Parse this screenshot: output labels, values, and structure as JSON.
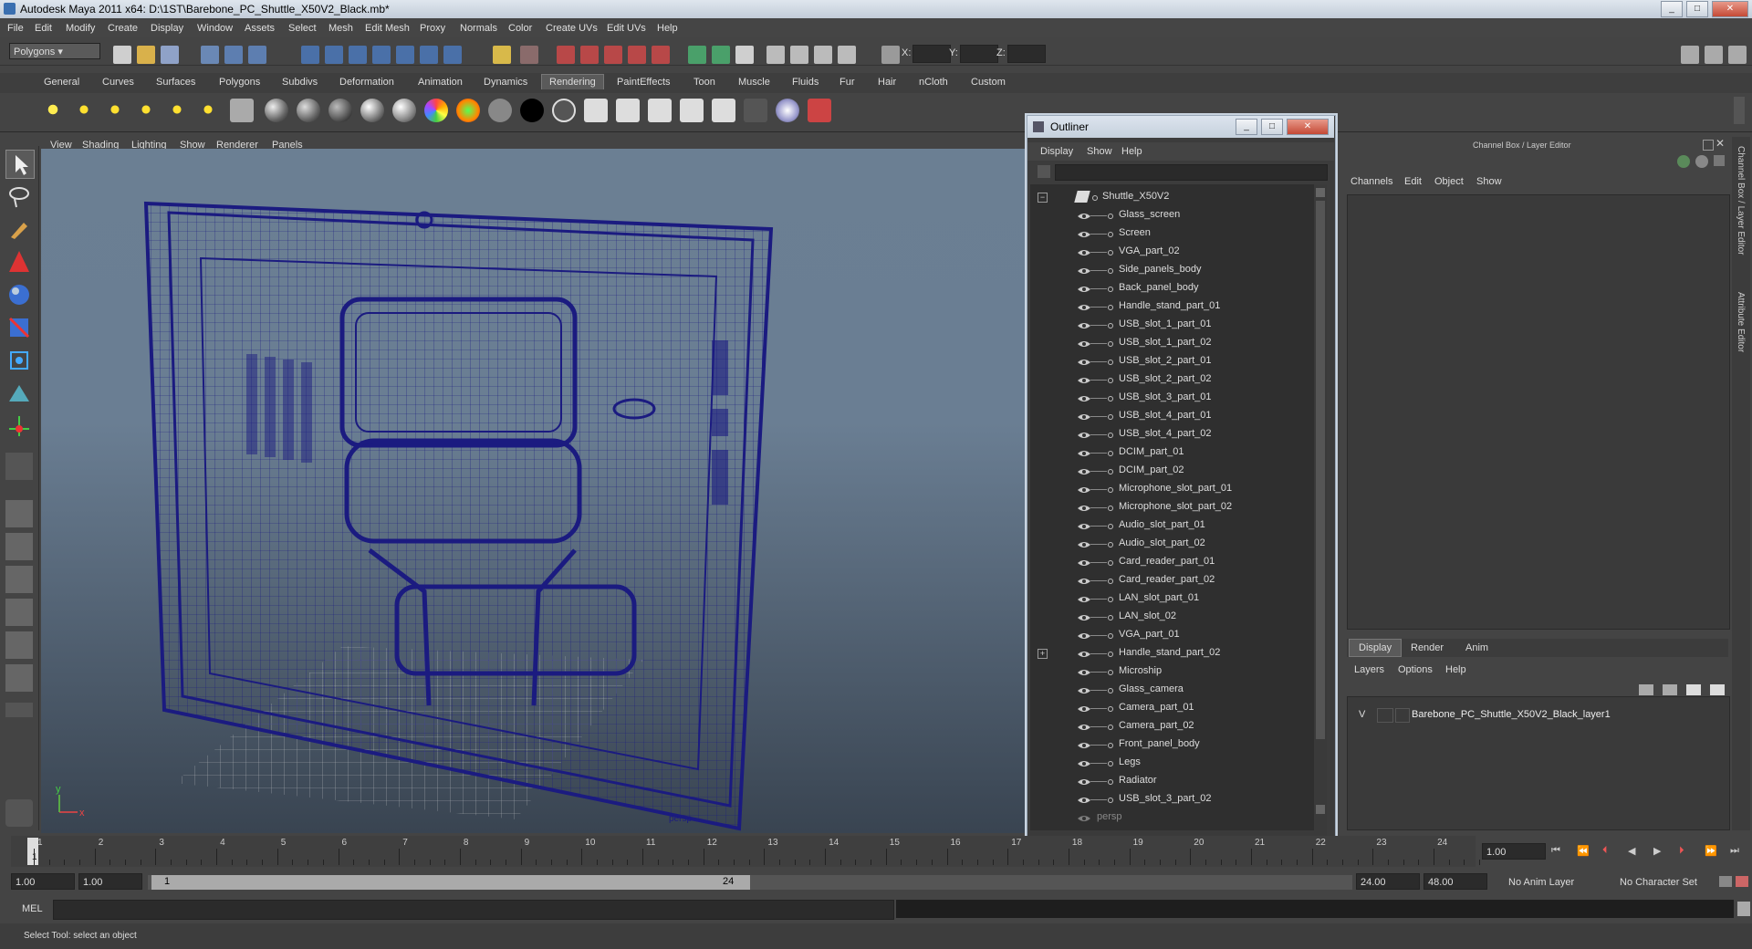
{
  "window": {
    "title": "Autodesk Maya 2011 x64: D:\\1ST\\Barebone_PC_Shuttle_X50V2_Black.mb*"
  },
  "menubar": [
    "File",
    "Edit",
    "Modify",
    "Create",
    "Display",
    "Window",
    "Assets",
    "Select",
    "Mesh",
    "Edit Mesh",
    "Proxy",
    "Normals",
    "Color",
    "Create UVs",
    "Edit UVs",
    "Help"
  ],
  "statusline": {
    "mode": "Polygons",
    "x_label": "X:",
    "y_label": "Y:",
    "z_label": "Z:"
  },
  "shelf": {
    "tabs": [
      "General",
      "Curves",
      "Surfaces",
      "Polygons",
      "Subdivs",
      "Deformation",
      "Animation",
      "Dynamics",
      "Rendering",
      "PaintEffects",
      "Toon",
      "Muscle",
      "Fluids",
      "Fur",
      "Hair",
      "nCloth",
      "Custom"
    ],
    "active": "Rendering"
  },
  "viewport": {
    "menu": [
      "View",
      "Shading",
      "Lighting",
      "Show",
      "Renderer",
      "Panels"
    ],
    "camera_label": "persp",
    "axis_x": "x",
    "axis_y": "y"
  },
  "outliner": {
    "title": "Outliner",
    "menu": [
      "Display",
      "Show",
      "Help"
    ],
    "root": "Shuttle_X50V2",
    "items": [
      "Glass_screen",
      "Screen",
      "VGA_part_02",
      "Side_panels_body",
      "Back_panel_body",
      "Handle_stand_part_01",
      "USB_slot_1_part_01",
      "USB_slot_1_part_02",
      "USB_slot_2_part_01",
      "USB_slot_2_part_02",
      "USB_slot_3_part_01",
      "USB_slot_4_part_01",
      "USB_slot_4_part_02",
      "DCIM_part_01",
      "DCIM_part_02",
      "Microphone_slot_part_01",
      "Microphone_slot_part_02",
      "Audio_slot_part_01",
      "Audio_slot_part_02",
      "Card_reader_part_01",
      "Card_reader_part_02",
      "LAN_slot_part_01",
      "LAN_slot_02",
      "VGA_part_01",
      "Handle_stand_part_02",
      "Microship",
      "Glass_camera",
      "Camera_part_01",
      "Camera_part_02",
      "Front_panel_body",
      "Legs",
      "Radiator",
      "USB_slot_3_part_02"
    ],
    "expandable_item": "Handle_stand_part_02",
    "camera": "persp"
  },
  "channelbox": {
    "title": "Channel Box / Layer Editor",
    "menu": [
      "Channels",
      "Edit",
      "Object",
      "Show"
    ],
    "side_tabs": [
      "Channel Box / Layer Editor",
      "Attribute Editor"
    ],
    "layer_tabs": [
      "Display",
      "Render",
      "Anim"
    ],
    "active_layer_tab": "Display",
    "layer_menu": [
      "Layers",
      "Options",
      "Help"
    ],
    "layer": {
      "visible": "V",
      "name": "Barebone_PC_Shuttle_X50V2_Black_layer1"
    }
  },
  "timeline": {
    "ticks": [
      "1",
      "2",
      "3",
      "4",
      "5",
      "6",
      "7",
      "8",
      "9",
      "10",
      "11",
      "12",
      "13",
      "14",
      "15",
      "16",
      "17",
      "18",
      "19",
      "20",
      "21",
      "22",
      "23",
      "24"
    ],
    "current": "1",
    "current_field": "1.00"
  },
  "range": {
    "start": "1.00",
    "playback_start": "1.00",
    "slider_start": "1",
    "slider_end": "24",
    "playback_end": "24.00",
    "end": "48.00",
    "anim_layer": "No Anim Layer",
    "char_set": "No Character Set"
  },
  "cmdline": {
    "label": "MEL"
  },
  "helpline": {
    "text": "Select Tool: select an object"
  },
  "colors": {
    "wireframe": "#1b1b80",
    "accent": "#5285a6"
  }
}
